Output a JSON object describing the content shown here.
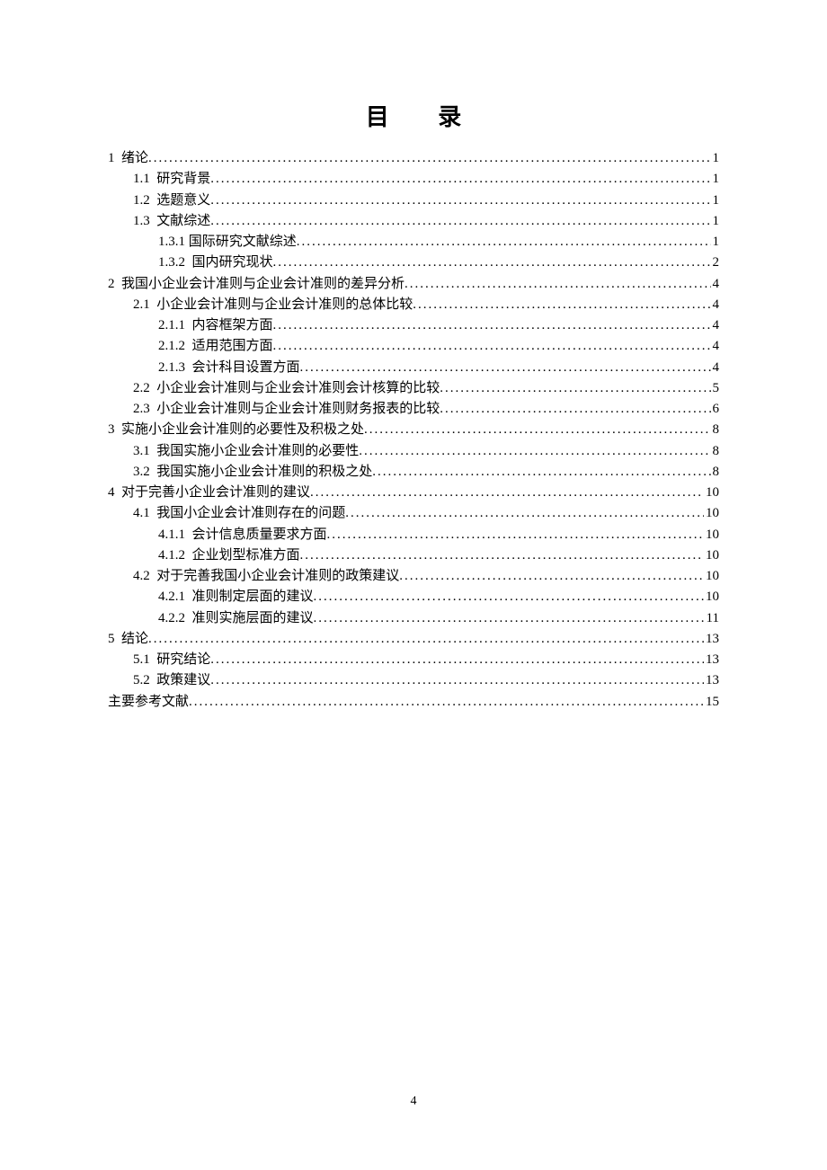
{
  "title": "目 录",
  "footer_page": "4",
  "toc": [
    {
      "indent": 0,
      "num": "1",
      "spacer": "  ",
      "label": "绪论",
      "page": "1"
    },
    {
      "indent": 1,
      "num": "1.1",
      "spacer": "  ",
      "label": "研究背景",
      "page": "1"
    },
    {
      "indent": 1,
      "num": "1.2",
      "spacer": "  ",
      "label": "选题意义",
      "page": "1"
    },
    {
      "indent": 1,
      "num": "1.3",
      "spacer": "  ",
      "label": "文献综述",
      "page": "1"
    },
    {
      "indent": 2,
      "num": "1.3.1",
      "spacer": " ",
      "label": "国际研究文献综述",
      "page": "1"
    },
    {
      "indent": 2,
      "num": "1.3.2",
      "spacer": "  ",
      "label": "国内研究现状",
      "page": "2"
    },
    {
      "indent": 0,
      "num": "2",
      "spacer": "  ",
      "label": "我国小企业会计准则与企业会计准则的差异分析",
      "page": "4"
    },
    {
      "indent": 1,
      "num": "2.1",
      "spacer": "  ",
      "label": "小企业会计准则与企业会计准则的总体比较",
      "page": "4"
    },
    {
      "indent": 2,
      "num": "2.1.1",
      "spacer": "  ",
      "label": "内容框架方面",
      "page": "4"
    },
    {
      "indent": 2,
      "num": "2.1.2",
      "spacer": "  ",
      "label": "适用范围方面",
      "page": "4"
    },
    {
      "indent": 2,
      "num": "2.1.3",
      "spacer": "  ",
      "label": "会计科目设置方面",
      "page": "4"
    },
    {
      "indent": 1,
      "num": "2.2",
      "spacer": "  ",
      "label": "小企业会计准则与企业会计准则会计核算的比较",
      "page": "5"
    },
    {
      "indent": 1,
      "num": "2.3",
      "spacer": "  ",
      "label": "小企业会计准则与企业会计准则财务报表的比较",
      "page": "6"
    },
    {
      "indent": 0,
      "num": "3",
      "spacer": "  ",
      "label": "实施小企业会计准则的必要性及积极之处",
      "page": "8"
    },
    {
      "indent": 1,
      "num": "3.1",
      "spacer": "  ",
      "label": "我国实施小企业会计准则的必要性",
      "page": "8"
    },
    {
      "indent": 1,
      "num": "3.2",
      "spacer": "  ",
      "label": "我国实施小企业会计准则的积极之处",
      "page": "8"
    },
    {
      "indent": 0,
      "num": "4",
      "spacer": "  ",
      "label": "对于完善小企业会计准则的建议",
      "page": "10"
    },
    {
      "indent": 1,
      "num": "4.1",
      "spacer": "  ",
      "label": "我国小企业会计准则存在的问题",
      "page": "10"
    },
    {
      "indent": 2,
      "num": "4.1.1",
      "spacer": "  ",
      "label": "会计信息质量要求方面",
      "page": "10"
    },
    {
      "indent": 2,
      "num": "4.1.2",
      "spacer": "  ",
      "label": "企业划型标准方面",
      "page": "10"
    },
    {
      "indent": 1,
      "num": "4.2",
      "spacer": "  ",
      "label": "对于完善我国小企业会计准则的政策建议",
      "page": "10"
    },
    {
      "indent": 2,
      "num": "4.2.1",
      "spacer": "  ",
      "label": "准则制定层面的建议",
      "page": "10"
    },
    {
      "indent": 2,
      "num": "4.2.2",
      "spacer": "  ",
      "label": "准则实施层面的建议",
      "page": "11"
    },
    {
      "indent": 0,
      "num": "5",
      "spacer": "  ",
      "label": "结论",
      "page": "13"
    },
    {
      "indent": 1,
      "num": "5.1",
      "spacer": "  ",
      "label": "研究结论",
      "page": "13"
    },
    {
      "indent": 1,
      "num": "5.2",
      "spacer": "  ",
      "label": "政策建议",
      "page": "13"
    },
    {
      "indent": 0,
      "num": "",
      "spacer": "",
      "label": "主要参考文献",
      "page": "15"
    }
  ]
}
